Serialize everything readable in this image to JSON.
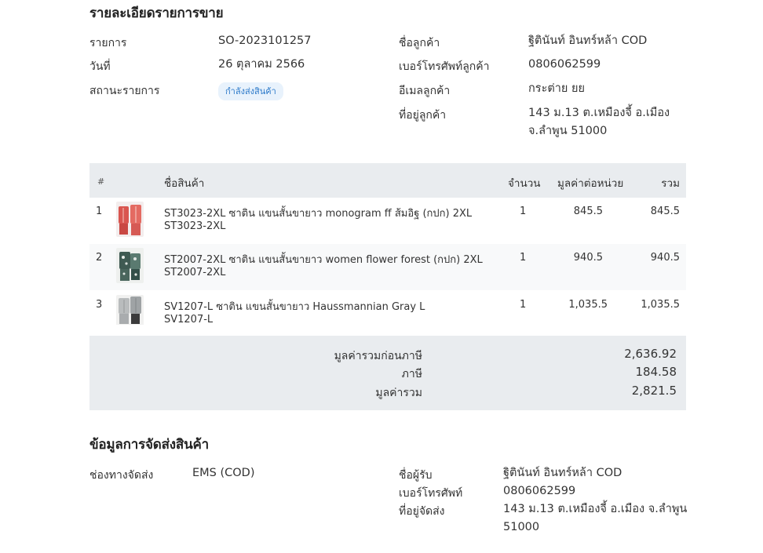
{
  "sales": {
    "title": "รายละเอียดรายการขาย",
    "labels": {
      "order": "รายการ",
      "date": "วันที่",
      "status": "สถานะรายการ",
      "customer_name": "ชื่อลูกค้า",
      "customer_phone": "เบอร์โทรศัพท์ลูกค้า",
      "customer_email": "อีเมลลูกค้า",
      "customer_address": "ที่อยู่ลูกค้า"
    },
    "values": {
      "order": "SO-2023101257",
      "date": "26 ตุลาคม 2566",
      "status": "กำลังส่งสินค้า",
      "customer_name": "ฐิตินันท์ อินทร์หล้า COD",
      "customer_phone": "0806062599",
      "customer_email": "กระต่าย ยย",
      "customer_address_line1": "143 ม.13 ต.เหมืองจี้ อ.เมือง",
      "customer_address_line2": "จ.ลำพูน 51000"
    },
    "status_color": "#2b79c9"
  },
  "table": {
    "headers": {
      "index": "#",
      "name": "ชื่อสินค้า",
      "qty": "จำนวน",
      "unit_price": "มูลค่าต่อหน่วย",
      "total": "รวม"
    },
    "rows": [
      {
        "index": "1",
        "name": "ST3023-2XL ซาติน แขนสั้นขายาว monogram ff ส้มอิฐ (กปก) 2XL",
        "sku": "ST3023-2XL",
        "qty": "1",
        "unit_price": "845.5",
        "total": "845.5",
        "thumb_icon": "red-pajama-thumbnail"
      },
      {
        "index": "2",
        "name": "ST2007-2XL ซาติน แขนสั้นขายาว women flower forest (กปก) 2XL",
        "sku": "ST2007-2XL",
        "qty": "1",
        "unit_price": "940.5",
        "total": "940.5",
        "thumb_icon": "floral-pajama-thumbnail"
      },
      {
        "index": "3",
        "name": "SV1207-L ซาติน แขนสั้นขายาว Haussmannian Gray L",
        "sku": "SV1207-L",
        "qty": "1",
        "unit_price": "1,035.5",
        "total": "1,035.5",
        "thumb_icon": "gray-pajama-thumbnail"
      }
    ]
  },
  "totals": {
    "subtotal_label": "มูลค่ารวมก่อนภาษี",
    "subtotal": "2,636.92",
    "tax_label": "ภาษี",
    "tax": "184.58",
    "grand_label": "มูลค่ารวม",
    "grand": "2,821.5"
  },
  "shipping": {
    "title": "ข้อมูลการจัดส่งสินค้า",
    "labels": {
      "channel": "ช่องทางจัดส่ง",
      "recipient": "ชื่อผู้รับ",
      "phone": "เบอร์โทรศัพท์",
      "address": "ที่อยู่จัดส่ง"
    },
    "values": {
      "channel": "EMS (COD)",
      "recipient": "ฐิตินันท์ อินทร์หล้า COD",
      "phone": "0806062599",
      "address_line1": "143 ม.13 ต.เหมืองจี้ อ.เมือง จ.ลำพูน",
      "address_line2": "51000"
    }
  }
}
